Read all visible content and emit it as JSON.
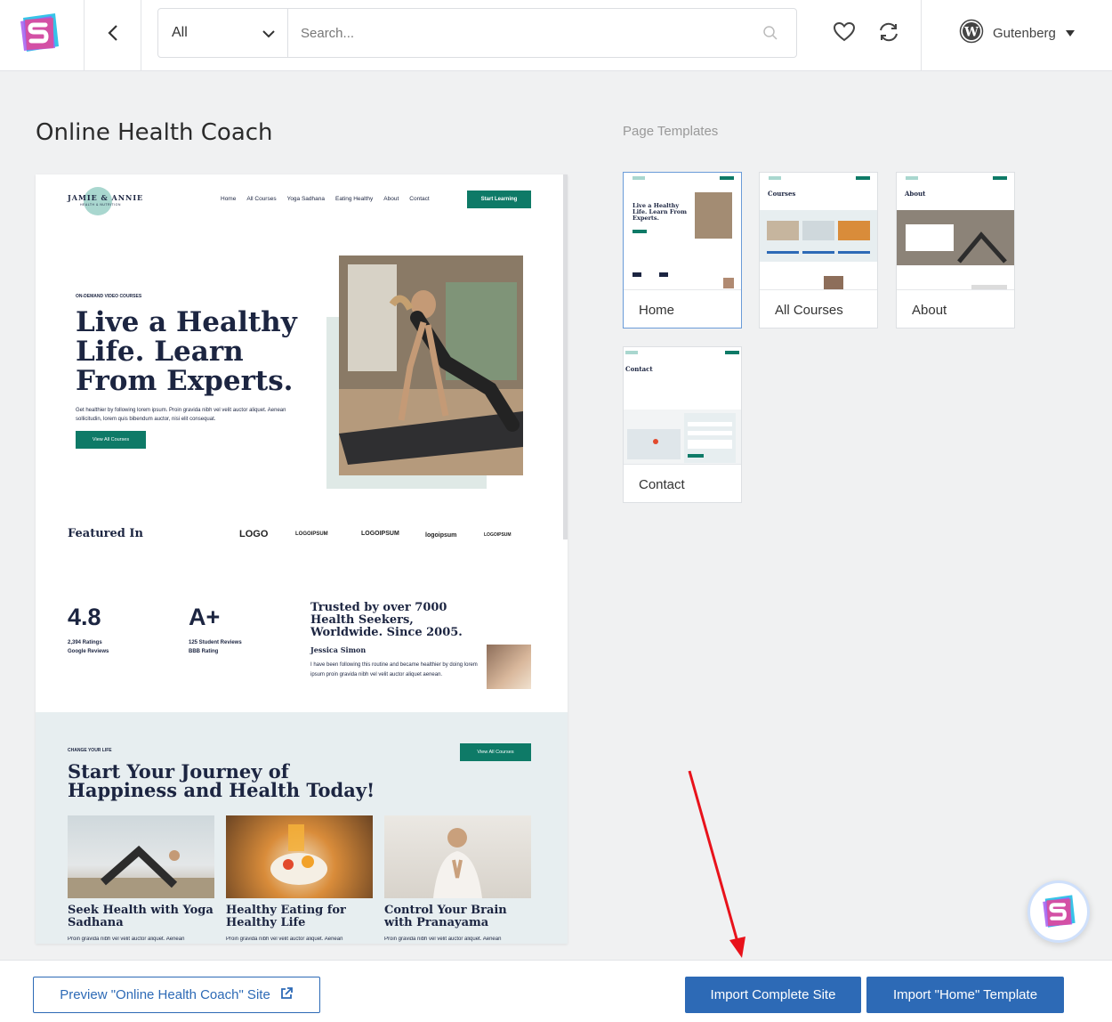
{
  "header": {
    "filter_value": "All",
    "search_placeholder": "Search...",
    "builder_label": "Gutenberg"
  },
  "site": {
    "title": "Online Health Coach"
  },
  "preview": {
    "logo_text": "JAMIE & ANNIE",
    "logo_sub": "HEALTH & NUTRITION",
    "nav": [
      "Home",
      "All Courses",
      "Yoga Sadhana",
      "Eating Healthy",
      "About",
      "Contact"
    ],
    "cta": "Start Learning",
    "kicker": "ON-DEMAND VIDEO COURSES",
    "hero_heading": "Live a Healthy Life. Learn From Experts.",
    "hero_text": "Get healthier by following lorem ipsum. Proin gravida nibh vel velit auctor aliquet. Aenean sollicitudin, lorem quis bibendum auctor, nisi elit consequat.",
    "hero_button": "View All Courses",
    "featured_label": "Featured In",
    "brands": [
      "LOGO",
      "LOGOIPSUM",
      "LOGOIPSUM",
      "logoipsum",
      "LOGOIPSUM"
    ],
    "stat1_value": "4.8",
    "stat1_label1": "2,394 Ratings",
    "stat1_label2": "Google Reviews",
    "stat2_value": "A+",
    "stat2_label1": "125 Student Reviews",
    "stat2_label2": "BBB Rating",
    "trust_heading": "Trusted by over 7000 Health Seekers, Worldwide. Since 2005.",
    "trust_name": "Jessica Simon",
    "trust_text": "I have been following this routine and became healthier by doing lorem ipsum proin gravida nibh vel velit auctor aliquet aenean.",
    "journey_kicker": "CHANGE YOUR LIFE",
    "journey_heading": "Start Your Journey of Happiness and Health Today!",
    "journey_button": "View All Courses",
    "cards": [
      {
        "title": "Seek Health with Yoga Sadhana",
        "text": "Proin gravida nibh vel velit auctor aliquet. Aenean"
      },
      {
        "title": "Healthy Eating for Healthy Life",
        "text": "Proin gravida nibh vel velit auctor aliquet. Aenean"
      },
      {
        "title": "Control Your Brain with Pranayama",
        "text": "Proin gravida nibh vel velit auctor aliquet. Aenean"
      }
    ]
  },
  "templates": {
    "label": "Page Templates",
    "items": [
      {
        "name": "Home",
        "heading": "Live a Healthy Life. Learn From Experts."
      },
      {
        "name": "All Courses",
        "heading": "Courses"
      },
      {
        "name": "About",
        "heading": "About"
      },
      {
        "name": "Contact",
        "heading": "Contact"
      }
    ]
  },
  "footer": {
    "preview_button": "Preview \"Online Health Coach\" Site",
    "import_site_button": "Import Complete Site",
    "import_template_button": "Import \"Home\" Template"
  },
  "colors": {
    "accent_blue": "#2d6ab6",
    "brand_green": "#0e7a67",
    "heading_navy": "#1c2541"
  }
}
